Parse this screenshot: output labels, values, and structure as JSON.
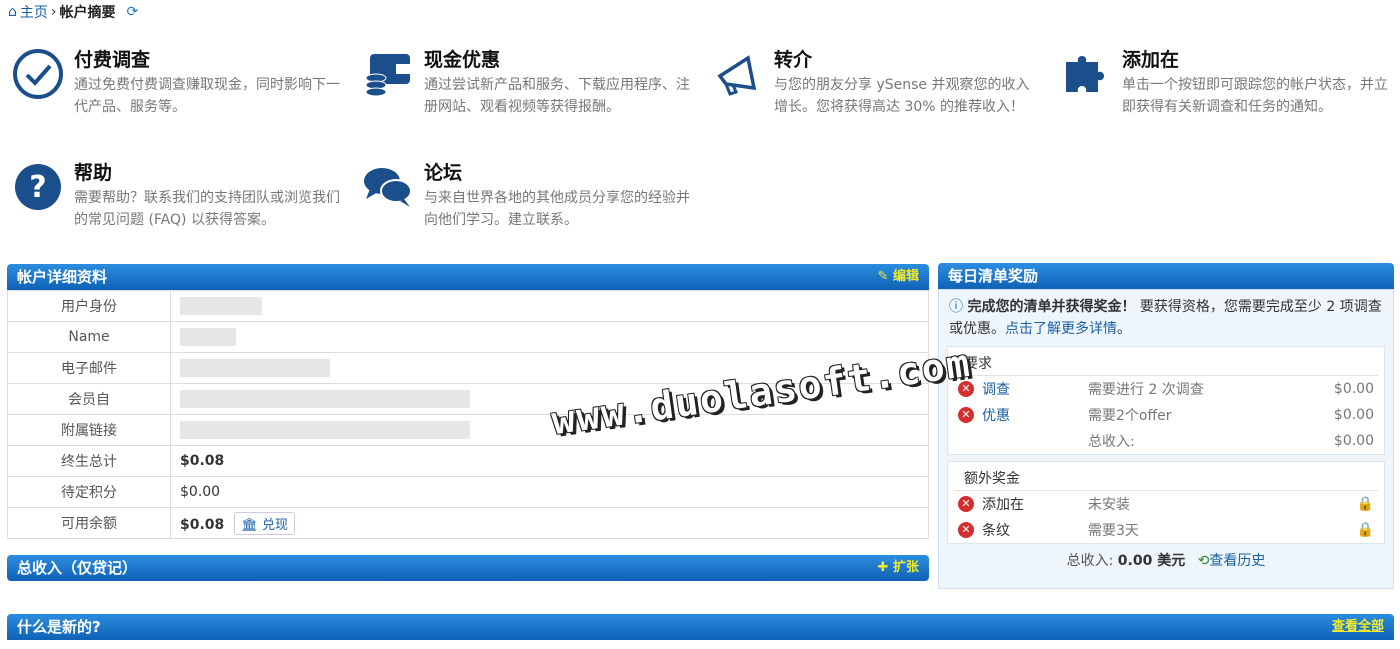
{
  "breadcrumb": {
    "home": "主页",
    "sep": "›",
    "current": "帐户摘要"
  },
  "features": [
    {
      "title": "付费调查",
      "desc": "通过免费付费调查赚取现金，同时影响下一代产品、服务等。"
    },
    {
      "title": "现金优惠",
      "desc": "通过尝试新产品和服务、下载应用程序、注册网站、观看视频等获得报酬。"
    },
    {
      "title": "转介",
      "desc": "与您的朋友分享 ySense 并观察您的收入增长。您将获得高达 30% 的推荐收入！"
    },
    {
      "title": "添加在",
      "desc": "单击一个按钮即可跟踪您的帐户状态，并立即获得有关新调查和任务的通知。"
    },
    {
      "title": "帮助",
      "desc": "需要帮助？联系我们的支持团队或浏览我们的常见问题 (FAQ) 以获得答案。"
    },
    {
      "title": "论坛",
      "desc": "与来自世界各地的其他成员分享您的经验并向他们学习。建立联系。"
    }
  ],
  "account": {
    "title": "帐户详细资料",
    "edit": "编辑",
    "rows": [
      {
        "label": "用户身份",
        "value": ""
      },
      {
        "label": "Name",
        "value": ""
      },
      {
        "label": "电子邮件",
        "value": ""
      },
      {
        "label": "会员自",
        "value": ""
      },
      {
        "label": "附属链接",
        "value": ""
      },
      {
        "label": "终生总计",
        "value": "$0.08"
      },
      {
        "label": "待定积分",
        "value": "$0.00"
      },
      {
        "label": "可用余额",
        "value": "$0.08"
      }
    ],
    "cashout": "兑现"
  },
  "earnings": {
    "title": "总收入（仅贷记）",
    "expand": "扩张"
  },
  "news": {
    "title": "什么是新的?",
    "view_all": "查看全部"
  },
  "daily": {
    "title": "每日清单奖励",
    "info_bold": "完成您的清单并获得奖金！",
    "info_text": "要获得资格，您需要完成至少 2 项调查或优惠。",
    "info_link": "点击了解更多详情",
    "info_end": "。",
    "req_title": "要求",
    "reqs": [
      {
        "name": "调查",
        "desc": "需要进行 2 次调查",
        "amount": "$0.00"
      },
      {
        "name": "优惠",
        "desc": "需要2个offer",
        "amount": "$0.00"
      }
    ],
    "req_total_label": "总收入:",
    "req_total": "$0.00",
    "extra_title": "额外奖金",
    "extras": [
      {
        "name": "添加在",
        "desc": "未安装"
      },
      {
        "name": "条纹",
        "desc": "需要3天"
      }
    ],
    "total_label": "总收入:",
    "total_value": "0.00 美元",
    "history": "查看历史"
  },
  "watermark": "www.duolasoft.com"
}
